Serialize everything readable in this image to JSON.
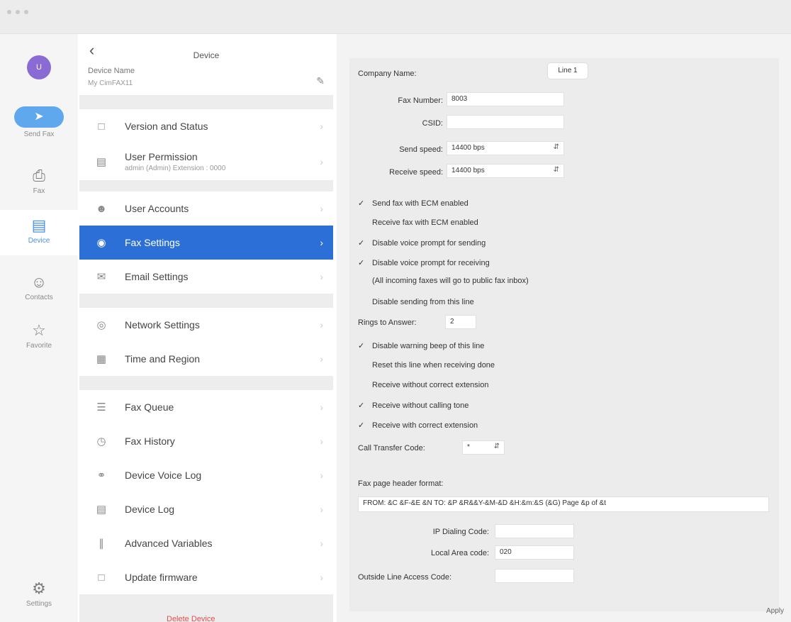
{
  "rail": {
    "avatar": "U",
    "items": [
      {
        "label": "Send Fax",
        "icon": "paper-plane-icon"
      },
      {
        "label": "Fax",
        "icon": "fax-icon"
      },
      {
        "label": "Device",
        "icon": "device-icon"
      },
      {
        "label": "Contacts",
        "icon": "contacts-icon"
      },
      {
        "label": "Favorite",
        "icon": "star-icon"
      },
      {
        "label": "Settings",
        "icon": "gear-icon"
      }
    ]
  },
  "list": {
    "title": "Device",
    "device_name_label": "Device Name",
    "device_name_value": "My CimFAX11",
    "items": [
      {
        "label": "Version and Status",
        "icon": "monitor-icon"
      },
      {
        "label": "User Permission",
        "sub": "admin (Admin)   Extension : 0000",
        "icon": "permission-icon"
      },
      {
        "label": "User Accounts",
        "icon": "user-icon"
      },
      {
        "label": "Fax Settings",
        "icon": "fax-settings-icon"
      },
      {
        "label": "Email Settings",
        "icon": "email-icon"
      },
      {
        "label": "Network Settings",
        "icon": "globe-icon"
      },
      {
        "label": "Time and Region",
        "icon": "calendar-icon"
      },
      {
        "label": "Fax Queue",
        "icon": "queue-icon"
      },
      {
        "label": "Fax History",
        "icon": "history-icon"
      },
      {
        "label": "Device Voice Log",
        "icon": "headset-icon"
      },
      {
        "label": "Device Log",
        "icon": "log-icon"
      },
      {
        "label": "Advanced Variables",
        "icon": "variables-icon"
      },
      {
        "label": "Update firmware",
        "icon": "monitor-icon"
      }
    ]
  },
  "panel": {
    "company_name_label": "Company Name:",
    "line_tab": "Line 1",
    "fax_number_label": "Fax Number:",
    "fax_number_value": "8003",
    "csid_label": "CSID:",
    "csid_value": "",
    "send_speed_label": "Send speed:",
    "send_speed_value": "14400 bps",
    "receive_speed_label": "Receive speed:",
    "receive_speed_value": "14400 bps",
    "checks_a": [
      {
        "label": "Send fax with ECM enabled",
        "checked": true
      },
      {
        "label": "Receive fax with ECM enabled",
        "checked": false
      },
      {
        "label": "Disable voice prompt for sending",
        "checked": true
      },
      {
        "label": "Disable voice prompt for receiving",
        "checked": true
      }
    ],
    "receiving_note": "(All incoming faxes will go to public fax inbox)",
    "disable_sending_label": "Disable sending from this line",
    "rings_label": "Rings to Answer:",
    "rings_value": "2",
    "checks_b": [
      {
        "label": "Disable warning beep of this line",
        "checked": true
      },
      {
        "label": "Reset this line when receiving done",
        "checked": false
      },
      {
        "label": "Receive without correct extension",
        "checked": false
      },
      {
        "label": "Receive without calling tone",
        "checked": true
      },
      {
        "label": "Receive with correct extension",
        "checked": true
      }
    ],
    "call_transfer_label": "Call Transfer Code:",
    "call_transfer_value": "*",
    "header_format_label": "Fax page header format:",
    "header_format_value": "FROM: &C &F-&E &N    TO: &P &R&&Y-&M-&D &H:&m:&S (&G) Page &p of &t",
    "ip_dialing_label": "IP Dialing Code:",
    "ip_dialing_value": "",
    "local_area_label": "Local Area code:",
    "local_area_value": "020",
    "outside_line_label": "Outside Line Access Code:",
    "outside_line_value": "",
    "apply_label": "Apply"
  },
  "bottom_peek": "Delete Device"
}
